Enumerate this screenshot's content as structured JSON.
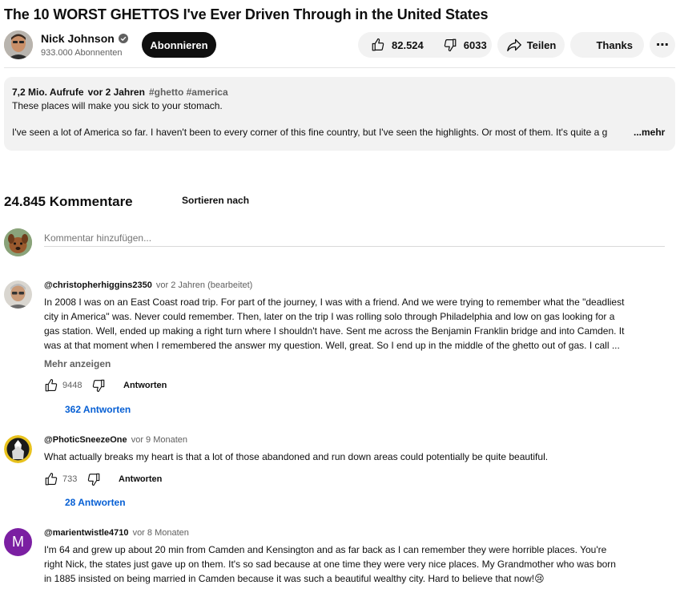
{
  "video": {
    "title": "The 10 WORST GHETTOS I've Ever Driven Through in the United States"
  },
  "channel": {
    "name": "Nick Johnson",
    "subscribers": "933.000 Abonnenten",
    "subscribe_label": "Abonnieren"
  },
  "actions": {
    "likes": "82.524",
    "dislikes": "6033",
    "share_label": "Teilen",
    "thanks_label": "Thanks",
    "more_label": "⋯"
  },
  "description": {
    "views": "7,2 Mio. Aufrufe",
    "age": "vor 2 Jahren",
    "tags": "#ghetto #america",
    "line1": "These places will make you sick to your stomach.",
    "line2": "I've seen a lot of America so far. I haven't been to every corner of this fine country, but I've seen the highlights. Or most of them. It's quite a g",
    "more_label": "...mehr"
  },
  "comments_section": {
    "count_label": "24.845 Kommentare",
    "sort_label": "Sortieren nach",
    "add_placeholder": "Kommentar hinzufügen..."
  },
  "comments": [
    {
      "author": "@christopherhiggins2350",
      "time": "vor 2 Jahren (bearbeitet)",
      "lines": [
        "In 2008 I was on an East Coast road trip. For part of the journey, I was with a friend. And we were trying to remember what the \"deadliest",
        "city in America\" was. Never could remember. Then, later on the trip I was rolling solo through Philadelphia and low on gas looking for a",
        "gas station. Well, ended up making a right turn where I shouldn't have. Sent me across the Benjamin Franklin bridge and into Camden. It",
        "was at that moment when I remembered the answer my question. Well, great. So I end up in the middle of the ghetto out of gas. I call ..."
      ],
      "show_more": "Mehr anzeigen",
      "likes": "9448",
      "reply_label": "Antworten",
      "replies": "362 Antworten"
    },
    {
      "author": "@PhoticSneezeOne",
      "time": "vor 9 Monaten",
      "lines": [
        "What actually breaks my heart is that a lot of those abandoned and run down areas could potentially be quite beautiful."
      ],
      "likes": "733",
      "reply_label": "Antworten",
      "replies": "28 Antworten"
    },
    {
      "author": "@marientwistle4710",
      "time": "vor 8 Monaten",
      "avatar_letter": "M",
      "avatar_color": "#7b1fa2",
      "lines": [
        "I'm 64 and grew up about 20 min from Camden and Kensington and as far back as I can remember they were horrible places. You're",
        "right Nick, the states just gave up on them. It's so sad because at one time they were very nice places. My Grandmother who was born",
        "in 1885 insisted on being married in Camden because it was such a beautiful wealthy city. Hard to believe that now!😢"
      ]
    }
  ]
}
